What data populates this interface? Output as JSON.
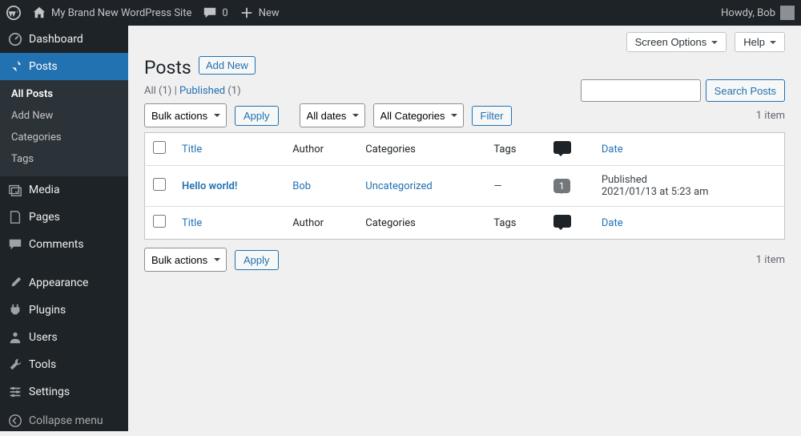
{
  "adminbar": {
    "site_title": "My Brand New WordPress Site",
    "comments_count": "0",
    "new_label": "New",
    "howdy": "Howdy, Bob"
  },
  "sidebar": {
    "dashboard": "Dashboard",
    "posts": "Posts",
    "submenu": {
      "all_posts": "All Posts",
      "add_new": "Add New",
      "categories": "Categories",
      "tags": "Tags"
    },
    "media": "Media",
    "pages": "Pages",
    "comments": "Comments",
    "appearance": "Appearance",
    "plugins": "Plugins",
    "users": "Users",
    "tools": "Tools",
    "settings": "Settings",
    "collapse": "Collapse menu"
  },
  "top": {
    "screen_options": "Screen Options",
    "help": "Help"
  },
  "header": {
    "title": "Posts",
    "add_new": "Add New"
  },
  "subsub": {
    "all_label": "All",
    "all_count": "(1)",
    "sep": " | ",
    "published_label": "Published",
    "published_count": "(1)"
  },
  "search": {
    "button": "Search Posts"
  },
  "filters": {
    "bulk": "Bulk actions",
    "apply": "Apply",
    "dates": "All dates",
    "categories": "All Categories",
    "filter": "Filter",
    "items": "1 item"
  },
  "columns": {
    "title": "Title",
    "author": "Author",
    "categories": "Categories",
    "tags": "Tags",
    "date": "Date"
  },
  "row": {
    "title": "Hello world!",
    "author": "Bob",
    "category": "Uncategorized",
    "tags": "—",
    "comments": "1",
    "date_status": "Published",
    "date_value": "2021/01/13 at 5:23 am"
  },
  "bottom": {
    "bulk": "Bulk actions",
    "apply": "Apply",
    "items": "1 item"
  }
}
